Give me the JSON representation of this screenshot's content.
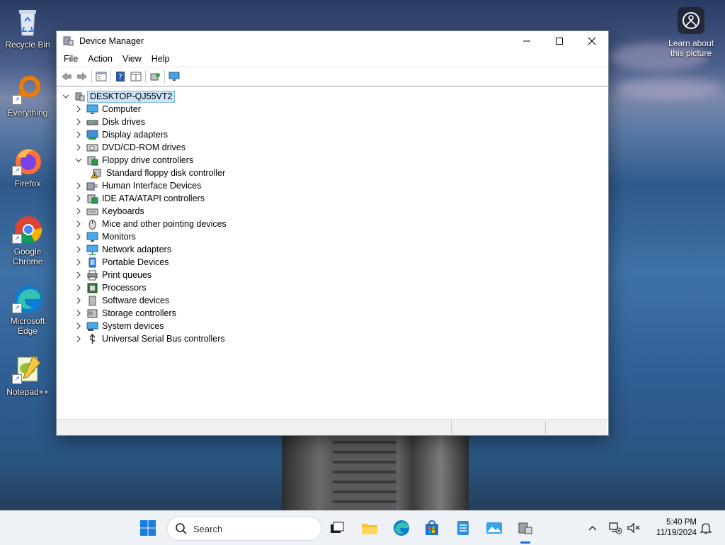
{
  "desktop": {
    "icons": [
      {
        "label": "Recycle Bin"
      },
      {
        "label": "Everything"
      },
      {
        "label": "Firefox"
      },
      {
        "label": "Google Chrome"
      },
      {
        "label": "Microsoft Edge"
      },
      {
        "label": "Notepad++"
      }
    ],
    "learn_about": "Learn about this picture"
  },
  "window": {
    "title": "Device Manager",
    "menu": [
      "File",
      "Action",
      "View",
      "Help"
    ],
    "tree": {
      "root": "DESKTOP-QJ55VT2",
      "items": [
        {
          "label": "Computer",
          "icon": "computer-icon"
        },
        {
          "label": "Disk drives",
          "icon": "disk-drive-icon"
        },
        {
          "label": "Display adapters",
          "icon": "display-adapter-icon"
        },
        {
          "label": "DVD/CD-ROM drives",
          "icon": "dvd-drive-icon"
        },
        {
          "label": "Floppy drive controllers",
          "icon": "floppy-controller-icon",
          "expanded": true
        },
        {
          "label": "Standard floppy disk controller",
          "icon": "warning-device-icon",
          "child": true
        },
        {
          "label": "Human Interface Devices",
          "icon": "hid-icon"
        },
        {
          "label": "IDE ATA/ATAPI controllers",
          "icon": "ide-controller-icon"
        },
        {
          "label": "Keyboards",
          "icon": "keyboard-icon"
        },
        {
          "label": "Mice and other pointing devices",
          "icon": "mouse-icon"
        },
        {
          "label": "Monitors",
          "icon": "monitor-icon"
        },
        {
          "label": "Network adapters",
          "icon": "network-adapter-icon"
        },
        {
          "label": "Portable Devices",
          "icon": "portable-device-icon"
        },
        {
          "label": "Print queues",
          "icon": "printer-icon"
        },
        {
          "label": "Processors",
          "icon": "processor-icon"
        },
        {
          "label": "Software devices",
          "icon": "software-device-icon"
        },
        {
          "label": "Storage controllers",
          "icon": "storage-controller-icon"
        },
        {
          "label": "System devices",
          "icon": "system-device-icon"
        },
        {
          "label": "Universal Serial Bus controllers",
          "icon": "usb-icon"
        }
      ]
    }
  },
  "taskbar": {
    "search_placeholder": "Search",
    "time": "5:40 PM",
    "date": "11/19/2024"
  },
  "colors": {
    "selection_bg": "#cce4f7",
    "accent": "#1a6fd6"
  }
}
